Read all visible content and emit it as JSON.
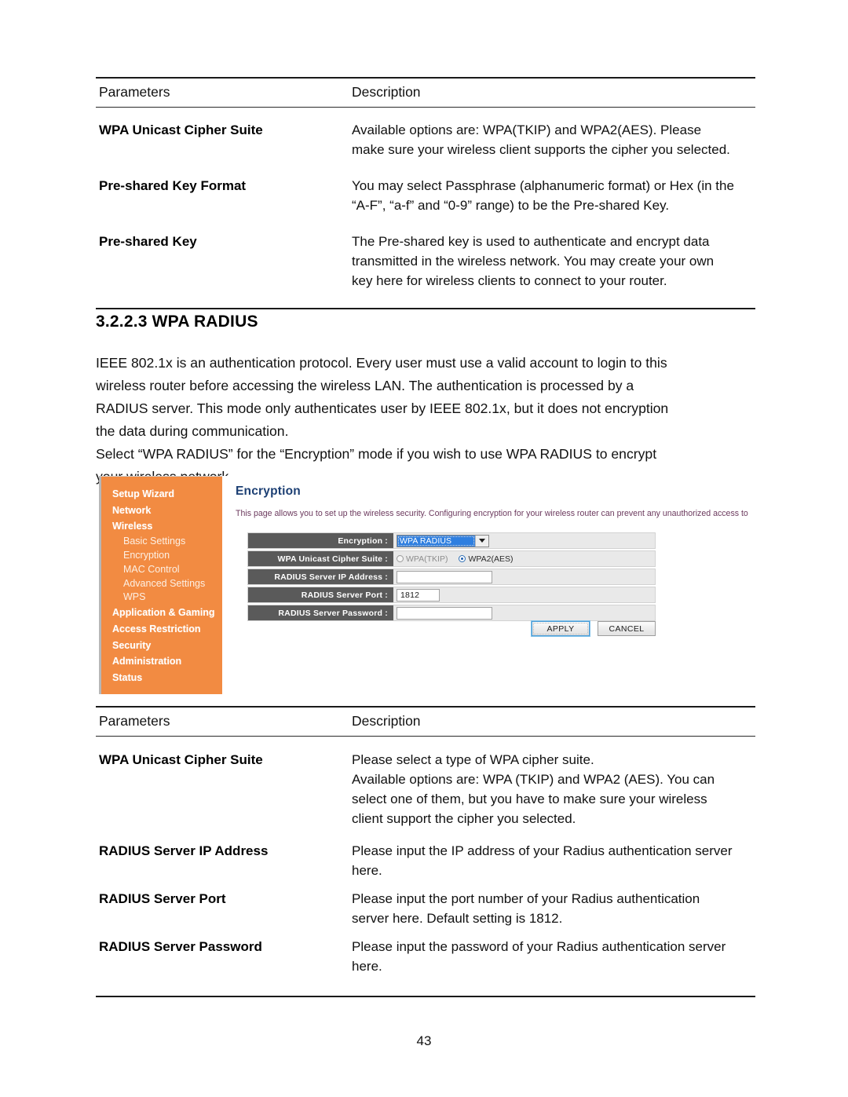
{
  "page": {
    "number": "43"
  },
  "table_top": {
    "headers": {
      "parameters": "Parameters",
      "description": "Description"
    },
    "rows": [
      {
        "name": "WPA Unicast Cipher Suite",
        "lines": [
          "Available options are: WPA(TKIP) and WPA2(AES). Please",
          "make sure your wireless client supports the cipher you selected."
        ]
      },
      {
        "name": "Pre-shared Key Format",
        "lines": [
          "You may select Passphrase (alphanumeric format) or Hex (in the",
          "“A-F”, “a-f” and “0-9” range) to be the Pre-shared Key."
        ]
      },
      {
        "name": "Pre-shared Key",
        "lines": [
          "The Pre-shared key is used to authenticate and encrypt data",
          "transmitted in the wireless network. You may create your own",
          "key here for wireless clients to connect to your router."
        ]
      }
    ]
  },
  "section": {
    "heading": "3.2.2.3 WPA RADIUS",
    "paragraph_lines": [
      "IEEE 802.1x is an authentication protocol. Every user must use a valid account to login to this",
      "wireless router before accessing the wireless LAN. The authentication is processed by a",
      "RADIUS server. This mode only authenticates user by IEEE 802.1x, but it does not encryption",
      "the data during communication.",
      "Select “WPA RADIUS” for the “Encryption” mode if you wish to use WPA RADIUS to encrypt",
      "your wireless network."
    ]
  },
  "router_ui": {
    "sidebar": {
      "items": [
        {
          "label": "Setup Wizard",
          "level": "top"
        },
        {
          "label": "Network",
          "level": "top"
        },
        {
          "label": "Wireless",
          "level": "top"
        },
        {
          "label": "Basic Settings",
          "level": "sub"
        },
        {
          "label": "Encryption",
          "level": "sub"
        },
        {
          "label": "MAC Control",
          "level": "sub"
        },
        {
          "label": "Advanced Settings",
          "level": "sub"
        },
        {
          "label": "WPS",
          "level": "sub"
        },
        {
          "label": "Application & Gaming",
          "level": "top"
        },
        {
          "label": "Access Restriction",
          "level": "top"
        },
        {
          "label": "Security",
          "level": "top"
        },
        {
          "label": "Administration",
          "level": "top"
        },
        {
          "label": "Status",
          "level": "top"
        }
      ],
      "background_color": "#F28B42",
      "text_color": "#FFFFFF"
    },
    "panel": {
      "title": "Encryption",
      "title_color": "#1C3F73",
      "description": "This page allows you to set up the wireless security. Configuring encryption for your wireless router can prevent any unauthorized access to",
      "description_color": "#6C3A5E"
    },
    "form": {
      "encryption": {
        "label": "Encryption :",
        "selected_option": "WPA RADIUS",
        "highlight_color": "#2F7FE0"
      },
      "cipher_suite": {
        "label": "WPA Unicast Cipher Suite :",
        "options": [
          {
            "label": "WPA(TKIP)",
            "selected": false
          },
          {
            "label": "WPA2(AES)",
            "selected": true
          }
        ]
      },
      "radius_ip": {
        "label": "RADIUS Server IP Address :",
        "value": ""
      },
      "radius_port": {
        "label": "RADIUS Server Port :",
        "value": "1812"
      },
      "radius_password": {
        "label": "RADIUS Server Password :",
        "value": ""
      },
      "buttons": {
        "apply": "APPLY",
        "cancel": "CANCEL"
      }
    }
  },
  "table_bottom": {
    "headers": {
      "parameters": "Parameters",
      "description": "Description"
    },
    "rows": [
      {
        "name": "WPA Unicast Cipher Suite",
        "lines": [
          "Please select a type of WPA cipher suite.",
          "Available options are: WPA (TKIP) and WPA2 (AES). You can",
          "select one of them, but you have to make sure your wireless",
          "client support the cipher you selected."
        ]
      },
      {
        "name": "RADIUS Server IP Address",
        "lines": [
          "Please input the IP address of your Radius authentication server",
          "here."
        ]
      },
      {
        "name": "RADIUS Server Port",
        "lines": [
          "Please input the port number of your Radius authentication",
          "server here. Default setting is 1812."
        ]
      },
      {
        "name": "RADIUS Server Password",
        "lines": [
          "Please input the password of your Radius authentication server",
          "here."
        ]
      }
    ]
  }
}
